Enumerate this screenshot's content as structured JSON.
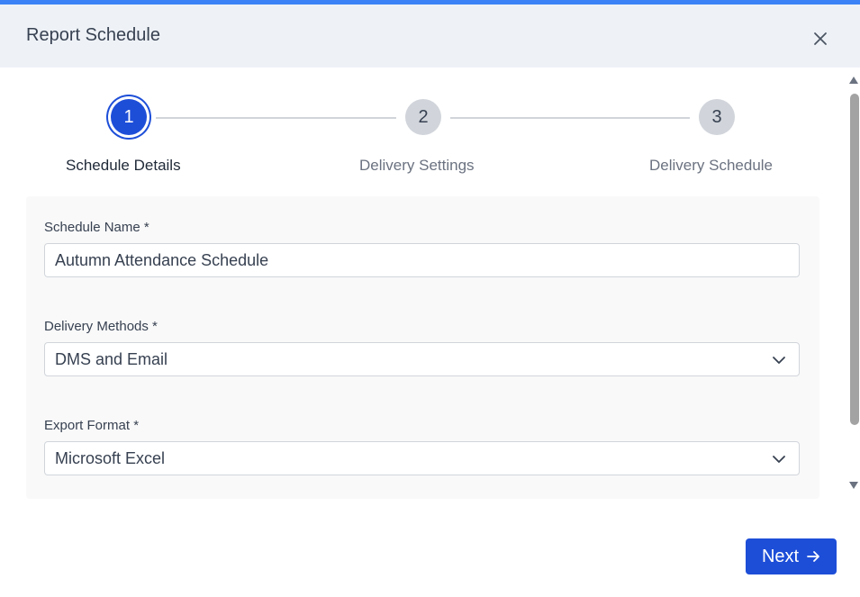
{
  "dialog": {
    "title": "Report Schedule"
  },
  "stepper": {
    "steps": [
      {
        "number": "1",
        "label": "Schedule Details",
        "active": true
      },
      {
        "number": "2",
        "label": "Delivery Settings",
        "active": false
      },
      {
        "number": "3",
        "label": "Delivery Schedule",
        "active": false
      }
    ]
  },
  "form": {
    "schedule_name": {
      "label": "Schedule Name *",
      "value": "Autumn Attendance Schedule"
    },
    "delivery_methods": {
      "label": "Delivery Methods *",
      "value": "DMS and Email"
    },
    "export_format": {
      "label": "Export Format *",
      "value": "Microsoft Excel"
    }
  },
  "footer": {
    "next_label": "Next"
  },
  "icons": {
    "close": "close-icon",
    "chevron": "chevron-down-icon",
    "arrow": "arrow-right-icon"
  },
  "colors": {
    "accent": "#1d4ed8",
    "top_bar": "#3b82f6",
    "header_bg": "#eef2f7"
  }
}
